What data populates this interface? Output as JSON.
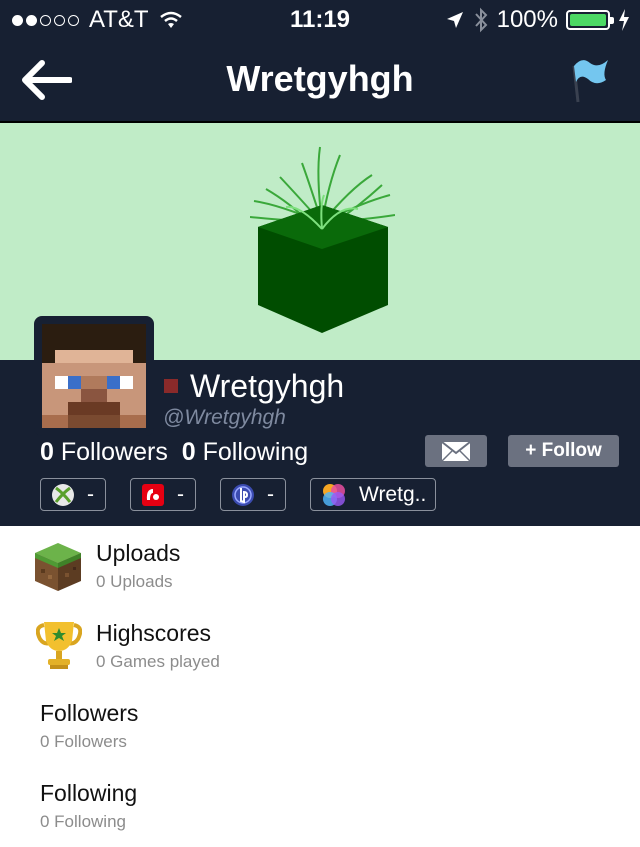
{
  "status_bar": {
    "carrier": "AT&T",
    "time": "11:19",
    "battery": "100%",
    "battery_level": 1.0,
    "signal_bars": 2
  },
  "nav": {
    "title": "Wretgyhgh"
  },
  "profile": {
    "name": "Wretgyhgh",
    "handle": "@Wretgyhgh",
    "followers_count": "0",
    "followers_label": "Followers",
    "following_count": "0",
    "following_label": "Following",
    "follow_button": "+ Follow",
    "status_color": "#8a2a2a"
  },
  "gamer_tags": [
    {
      "icon": "xbox-icon",
      "value": "-"
    },
    {
      "icon": "wii-icon",
      "value": "-"
    },
    {
      "icon": "playstation-icon",
      "value": "-"
    },
    {
      "icon": "game-center-icon",
      "value": "Wretg.."
    }
  ],
  "menu": [
    {
      "icon": "grass-block-icon",
      "title": "Uploads",
      "subtitle": "0 Uploads"
    },
    {
      "icon": "trophy-icon",
      "title": "Highscores",
      "subtitle": "0 Games played"
    },
    {
      "title": "Followers",
      "subtitle": "0 Followers"
    },
    {
      "title": "Following",
      "subtitle": "0 Following"
    }
  ],
  "colors": {
    "header_bg": "#172032",
    "banner_bg": "#c0ecc7",
    "button_bg": "#6b7180"
  }
}
